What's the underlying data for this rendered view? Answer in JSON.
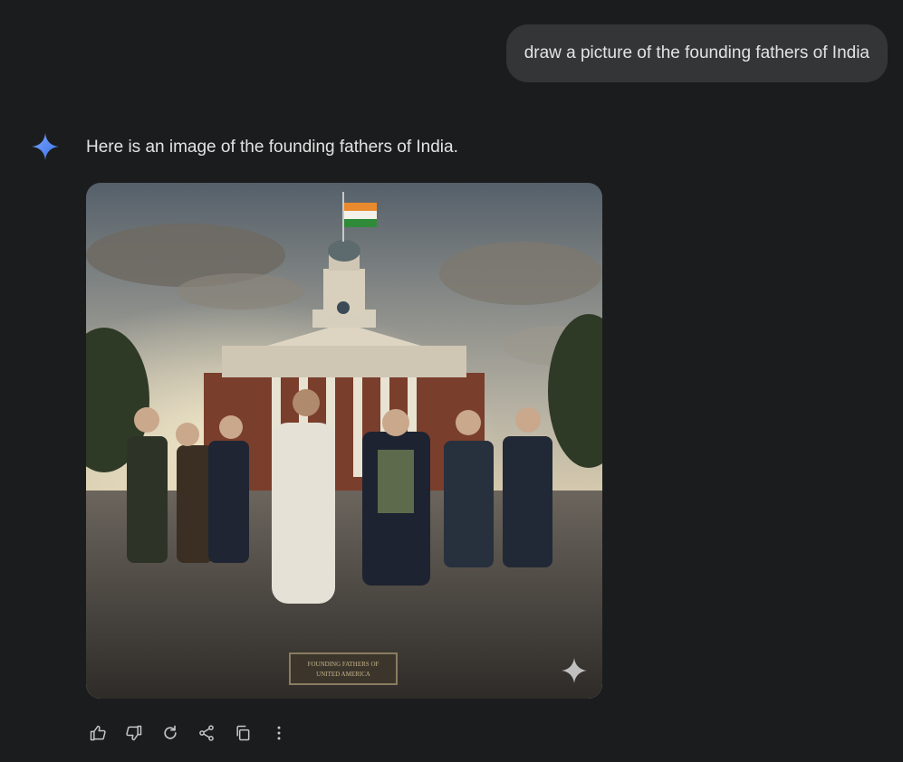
{
  "conversation": {
    "user_prompt": "draw a picture of the founding fathers of India",
    "response_text": "Here is an image of the founding fathers of India.",
    "image": {
      "plaque_text_line1": "FOUNDING FATHERS OF",
      "plaque_text_line2": "UNITED AMERICA"
    }
  },
  "actions": [
    {
      "icon": "thumbs-up-icon"
    },
    {
      "icon": "thumbs-down-icon"
    },
    {
      "icon": "regenerate-icon"
    },
    {
      "icon": "share-icon"
    },
    {
      "icon": "copy-icon"
    },
    {
      "icon": "more-vert-icon"
    }
  ],
  "colors": {
    "background": "#1b1c1d",
    "bubble": "#333537",
    "text": "#e3e3e3",
    "accent": "#4f8cf7"
  }
}
